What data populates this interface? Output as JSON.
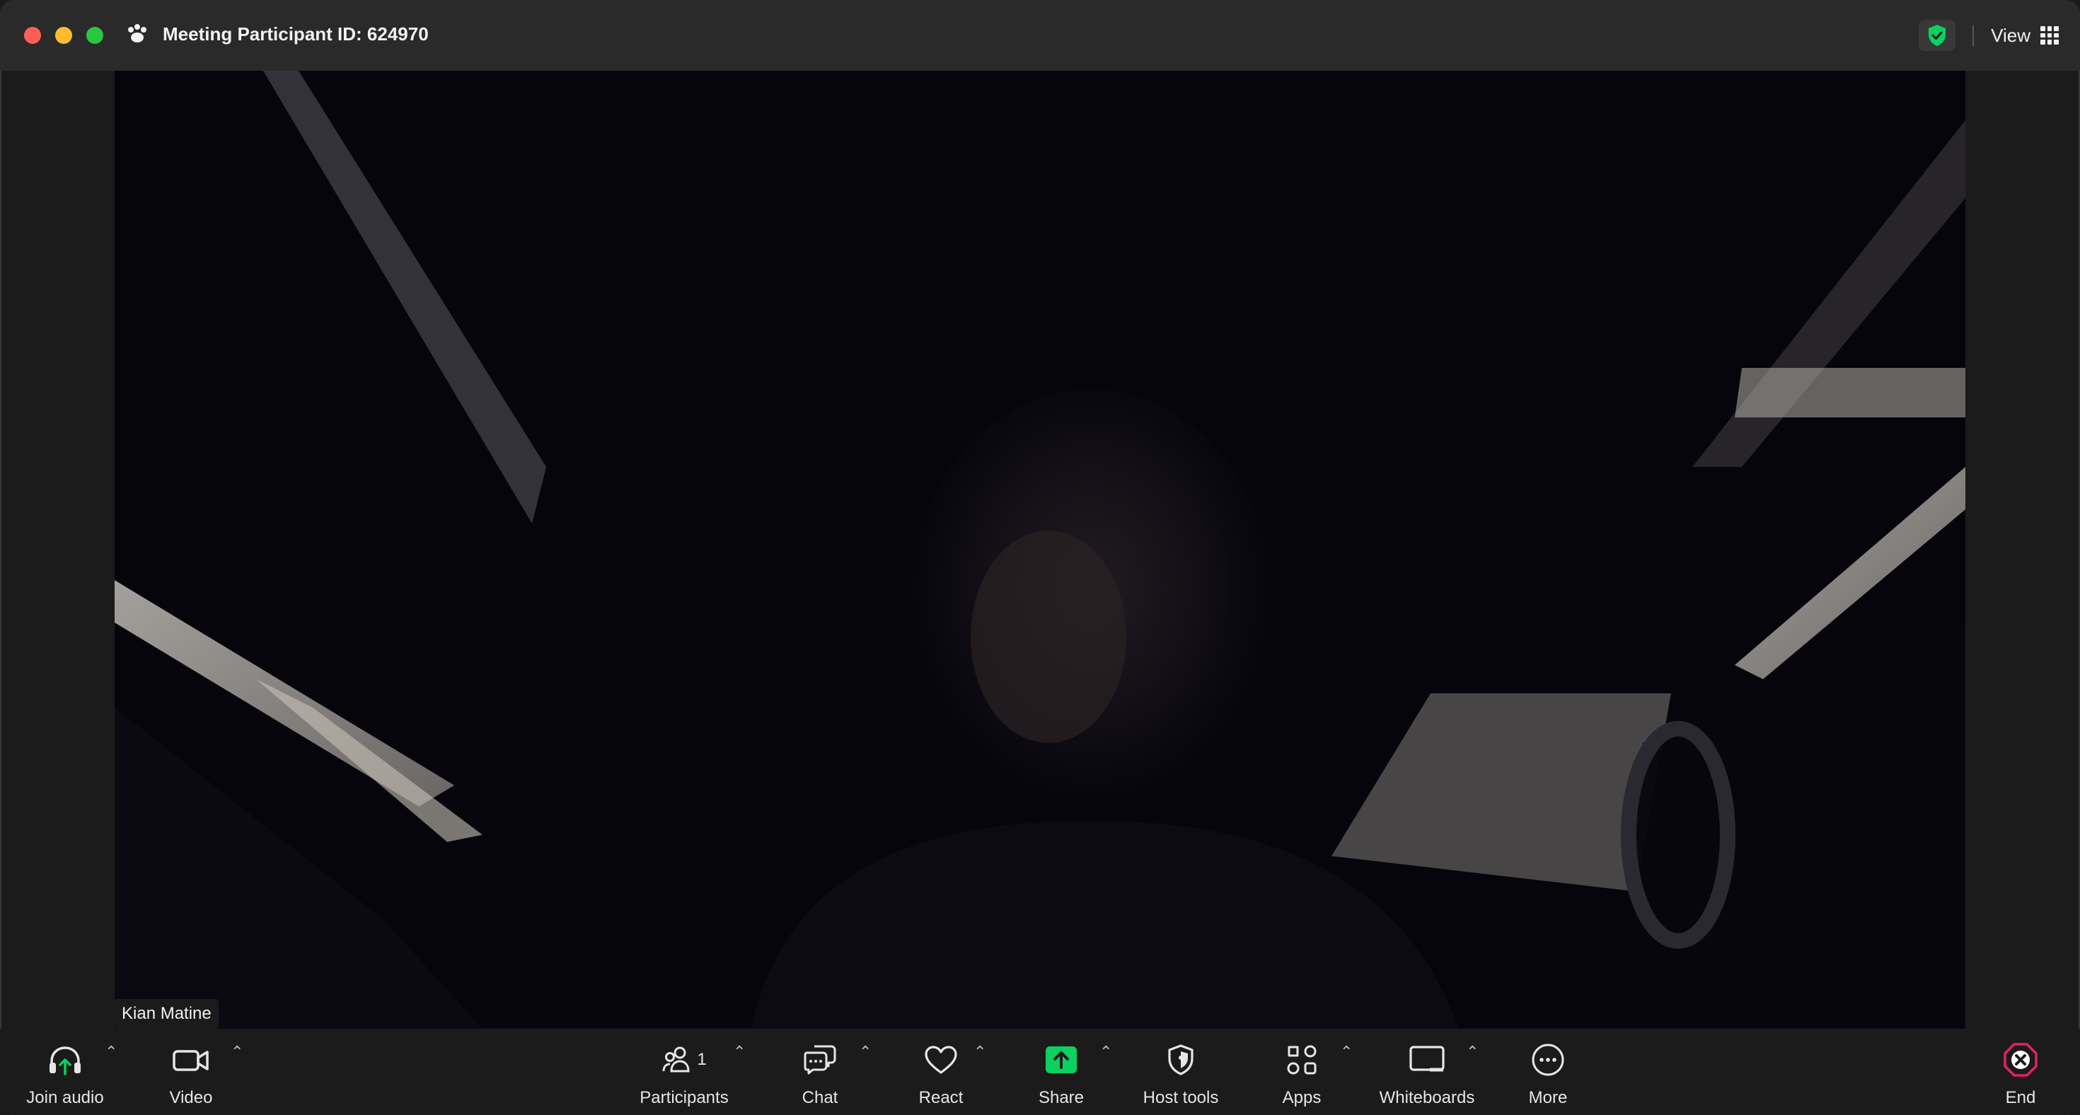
{
  "window": {
    "title": "Meeting Participant ID: 624970",
    "view_label": "View"
  },
  "video": {
    "participant_name": "Kian Matine"
  },
  "toolbar": {
    "join_audio": "Join audio",
    "video": "Video",
    "participants": "Participants",
    "participants_count": "1",
    "chat": "Chat",
    "react": "React",
    "share": "Share",
    "host_tools": "Host tools",
    "apps": "Apps",
    "whiteboards": "Whiteboards",
    "more": "More",
    "end": "End"
  },
  "colors": {
    "share_accent": "#0bd160",
    "end_accent": "#e0245e",
    "security_green": "#0bd160"
  },
  "icons": {
    "join_audio": "headphones-icon",
    "video": "camera-icon",
    "participants": "people-icon",
    "chat": "chat-bubbles-icon",
    "react": "heart-icon",
    "share": "share-arrow-icon",
    "host_tools": "shield-icon",
    "apps": "apps-icon",
    "whiteboards": "whiteboard-icon",
    "more": "ellipsis-icon",
    "end": "end-x-icon"
  }
}
